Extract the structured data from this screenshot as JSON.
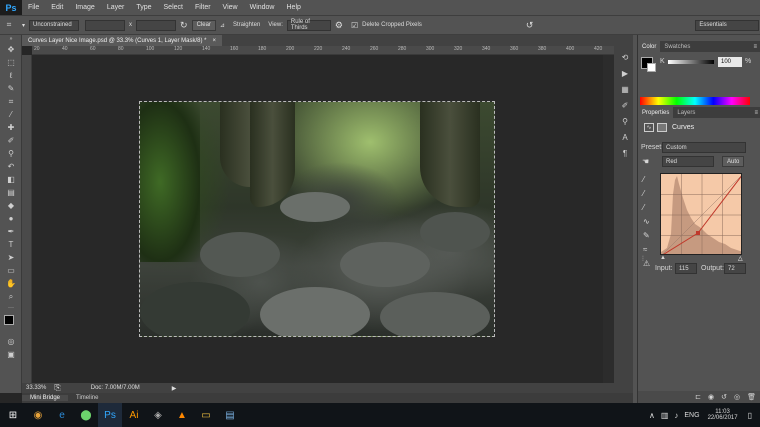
{
  "app": {
    "logo": "Ps",
    "menu": [
      "File",
      "Edit",
      "Image",
      "Layer",
      "Type",
      "Select",
      "Filter",
      "View",
      "Window",
      "Help"
    ]
  },
  "options_bar": {
    "ratio_value": "Unconstrained",
    "x_label": "x",
    "clear_label": "Clear",
    "straighten_label": "Straighten",
    "view_label": "View:",
    "view_value": "Rule of Thirds",
    "delete_cropped_label": "Delete Cropped Pixels",
    "delete_cropped_checked": true,
    "workspace": "Essentials"
  },
  "document": {
    "tab_title": "Curves Layer Nice Image.psd @ 33.3% (Curves 1, Layer Mask/8) *",
    "zoom": "33.33%",
    "doc_info": "Doc: 7.00M/7.00M"
  },
  "bottom_tabs": [
    "Mini Bridge",
    "Timeline"
  ],
  "color_panel": {
    "tabs": [
      "Color",
      "Swatches"
    ],
    "channel_label": "K",
    "channel_value": "100",
    "channel_unit": "%"
  },
  "properties_panel": {
    "tabs": [
      "Properties",
      "Layers"
    ],
    "title": "Curves",
    "preset_label": "Preset:",
    "preset_value": "Custom",
    "channel_value": "Red",
    "auto_label": "Auto",
    "input_label": "Input:",
    "input_value": "115",
    "output_label": "Output:",
    "output_value": "72"
  },
  "taskbar": {
    "lang": "ENG",
    "time": "11:03",
    "date": "22/06/2017"
  },
  "ruler_h_ticks": [
    "20",
    "40",
    "60",
    "80",
    "100",
    "120",
    "140",
    "160",
    "180",
    "200",
    "220",
    "240",
    "260",
    "280",
    "300",
    "320",
    "340",
    "360",
    "380",
    "400",
    "420"
  ],
  "colors": {
    "accent_ps": "#31a8ff",
    "curve_fill": "#f5c9a8",
    "curve_line": "#c0392b"
  }
}
